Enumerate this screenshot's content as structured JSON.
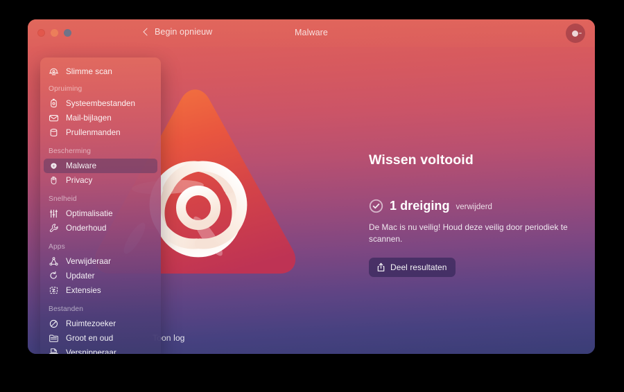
{
  "window": {
    "title": "Malware",
    "back_label": "Begin opnieuw",
    "traffic_lights": [
      "close-button",
      "minimize-button",
      "zoom-button"
    ],
    "account_icon": "account-avatar-icon"
  },
  "sidebar": {
    "top_item": {
      "label": "Slimme scan",
      "icon": "smart-scan-icon"
    },
    "groups": [
      {
        "label": "Opruiming",
        "items": [
          {
            "label": "Systeembestanden",
            "icon": "system-junk-icon"
          },
          {
            "label": "Mail-bijlagen",
            "icon": "mail-attachments-icon"
          },
          {
            "label": "Prullenmanden",
            "icon": "trash-bins-icon"
          }
        ]
      },
      {
        "label": "Bescherming",
        "items": [
          {
            "label": "Malware",
            "icon": "biohazard-icon",
            "active": true
          },
          {
            "label": "Privacy",
            "icon": "privacy-hand-icon"
          }
        ]
      },
      {
        "label": "Snelheid",
        "items": [
          {
            "label": "Optimalisatie",
            "icon": "sliders-icon"
          },
          {
            "label": "Onderhoud",
            "icon": "wrench-icon"
          }
        ]
      },
      {
        "label": "Apps",
        "items": [
          {
            "label": "Verwijderaar",
            "icon": "uninstaller-icon"
          },
          {
            "label": "Updater",
            "icon": "updater-refresh-icon"
          },
          {
            "label": "Extensies",
            "icon": "extensions-icon"
          }
        ]
      },
      {
        "label": "Bestanden",
        "items": [
          {
            "label": "Ruimtezoeker",
            "icon": "space-lens-icon"
          },
          {
            "label": "Groot en oud",
            "icon": "large-old-files-icon"
          },
          {
            "label": "Versnipperaar",
            "icon": "shredder-icon"
          }
        ]
      }
    ]
  },
  "main": {
    "hazard_icon": "biohazard-warning-triangle",
    "result_title": "Wissen voltooid",
    "check_icon": "check-circle-icon",
    "threat_count": "1 dreiging",
    "threat_state": "verwijderd",
    "description": "De Mac is nu veilig! Houd deze veilig door periodiek te scannen.",
    "share_button": {
      "label": "Deel resultaten",
      "icon": "share-icon"
    },
    "show_log": "Toon log"
  },
  "colors": {
    "gradient_top": "#e0675c",
    "gradient_bottom": "#3a3d76",
    "hazard_triangle_top": "#ef6a4a",
    "hazard_triangle_bottom": "#c6374f",
    "active_nav": "#5a3a64",
    "share_button_bg": "#2f2454"
  }
}
